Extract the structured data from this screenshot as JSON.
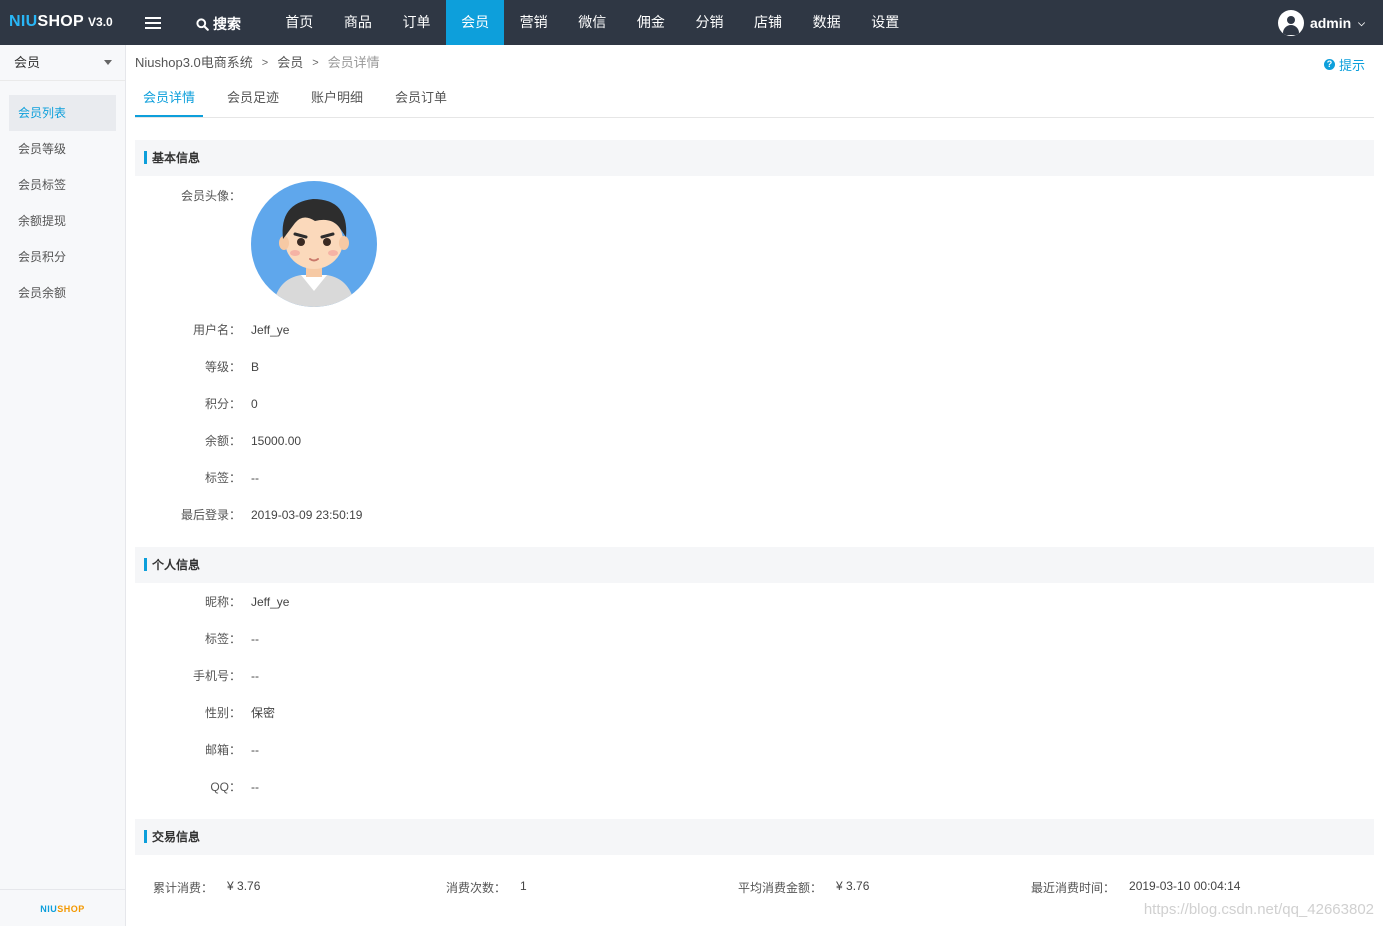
{
  "topbar": {
    "logo_a": "NIU",
    "logo_b": "SHOP",
    "logo_ver": "V3.0",
    "search_label": "搜索",
    "nav": [
      "首页",
      "商品",
      "订单",
      "会员",
      "营销",
      "微信",
      "佣金",
      "分销",
      "店铺",
      "数据",
      "设置"
    ],
    "active_nav": "会员",
    "user_name": "admin"
  },
  "sidebar": {
    "title": "会员",
    "items": [
      "会员列表",
      "会员等级",
      "会员标签",
      "余额提现",
      "会员积分",
      "会员余额"
    ],
    "active_item": "会员列表",
    "footer_logo_a": "NIU",
    "footer_logo_b": "SHOP"
  },
  "breadcrumb": {
    "root": "Niushop3.0电商系统",
    "level1": "会员",
    "current": "会员详情",
    "separator": ">"
  },
  "hint_label": "提示",
  "tabs": [
    "会员详情",
    "会员足迹",
    "账户明细",
    "会员订单"
  ],
  "basic_info": {
    "title": "基本信息",
    "avatar_label": "会员头像：",
    "fields": [
      {
        "label": "用户名：",
        "value": "Jeff_ye"
      },
      {
        "label": "等级：",
        "value": "B"
      },
      {
        "label": "积分：",
        "value": "0"
      },
      {
        "label": "余额：",
        "value": "15000.00"
      },
      {
        "label": "标签：",
        "value": "--"
      },
      {
        "label": "最后登录：",
        "value": "2019-03-09 23:50:19"
      }
    ]
  },
  "personal_info": {
    "title": "个人信息",
    "fields": [
      {
        "label": "昵称：",
        "value": "Jeff_ye"
      },
      {
        "label": "标签：",
        "value": "--"
      },
      {
        "label": "手机号：",
        "value": "--"
      },
      {
        "label": "性别：",
        "value": "保密"
      },
      {
        "label": "邮箱：",
        "value": "--"
      },
      {
        "label": "QQ：",
        "value": "--"
      }
    ]
  },
  "trade_info": {
    "title": "交易信息",
    "items": [
      {
        "label": "累计消费：",
        "value": "¥ 3.76"
      },
      {
        "label": "消费次数：",
        "value": "1"
      },
      {
        "label": "平均消费金额：",
        "value": "¥ 3.76"
      },
      {
        "label": "最近消费时间：",
        "value": "2019-03-10 00:04:14"
      }
    ]
  },
  "watermark": "https://blog.csdn.net/qq_42663802",
  "colors": {
    "topbar_bg": "#2f3744",
    "accent": "#0d9fdb",
    "sidebar_bg": "#f7f8fa"
  }
}
